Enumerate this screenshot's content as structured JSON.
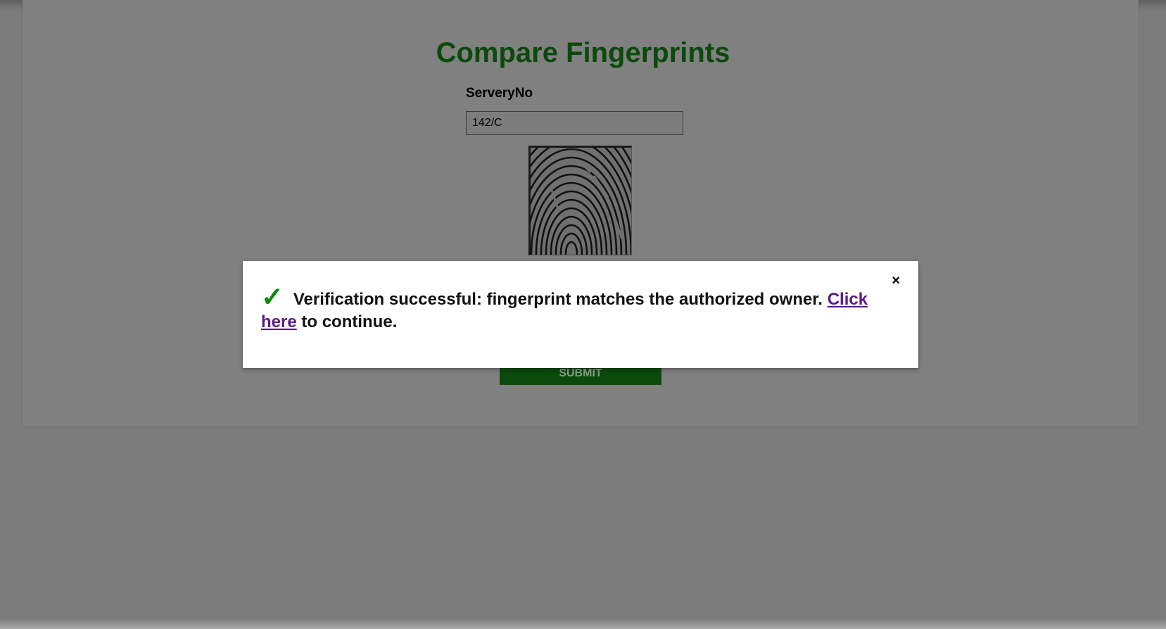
{
  "page": {
    "title": "Compare Fingerprints"
  },
  "form": {
    "field_label": "ServeryNo",
    "field_value": "142/C",
    "submit_label": "SUBMIT"
  },
  "modal": {
    "close_label": "×",
    "check_icon": "✓",
    "message_text": "Verification successful: fingerprint matches the authorized owner.",
    "link_text": "Click here",
    "suffix_text": "to continue.",
    "link_color": "#5b1a8c",
    "check_color": "#0a8a0a"
  },
  "colors": {
    "title": "#0b4a0b",
    "submit_bg": "#0b4a0b",
    "overlay": "#7b7b7b"
  },
  "icons": {
    "fingerprint": "fingerprint-image",
    "check": "check-icon",
    "close": "close-icon"
  }
}
